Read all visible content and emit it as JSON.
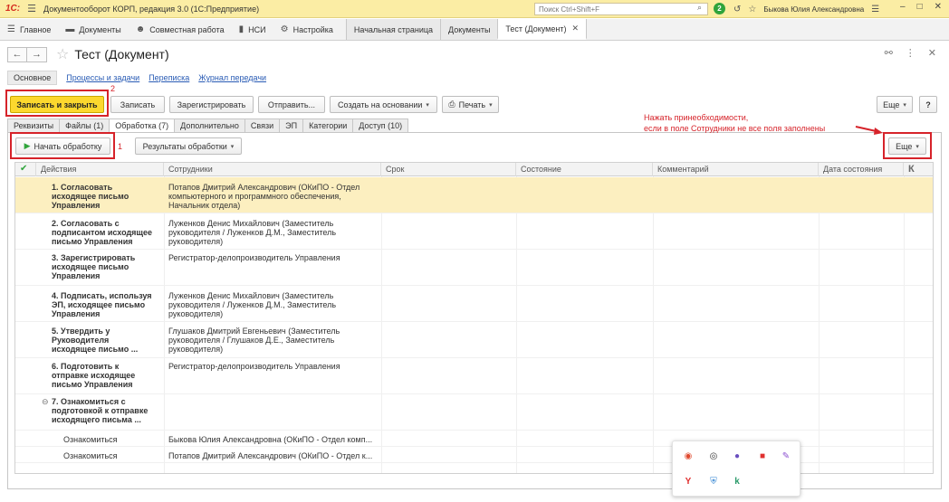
{
  "titlebar": {
    "logo": "1С:",
    "app_title": "Документооборот КОРП, редакция 3.0  (1С:Предприятие)",
    "search_placeholder": "Поиск Ctrl+Shift+F",
    "notification_count": "2",
    "user_name": "Быкова Юлия Александровна"
  },
  "navbar": {
    "sections": [
      {
        "label": "Главное",
        "icon": "menu-icon"
      },
      {
        "label": "Документы",
        "icon": "folder-icon"
      },
      {
        "label": "Совместная работа",
        "icon": "people-icon"
      },
      {
        "label": "НСИ",
        "icon": "book-icon"
      },
      {
        "label": "Настройка",
        "icon": "gear-icon"
      }
    ],
    "open_tabs": [
      {
        "label": "Начальная страница"
      },
      {
        "label": "Документы"
      },
      {
        "label": "Тест (Документ)"
      }
    ]
  },
  "form": {
    "title": "Тест (Документ)",
    "subnav": {
      "current": "Основное",
      "links": [
        "Процессы и задачи",
        "Переписка",
        "Журнал передачи"
      ]
    },
    "toolbar": {
      "save_close": "Записать и закрыть",
      "save": "Записать",
      "register": "Зарегистрировать",
      "send": "Отправить...",
      "create_based": "Создать на основании",
      "print": "Печать",
      "more": "Еще",
      "help": "?"
    },
    "tabs": [
      "Реквизиты",
      "Файлы (1)",
      "Обработка (7)",
      "Дополнительно",
      "Связи",
      "ЭП",
      "Категории",
      "Доступ (10)"
    ],
    "active_tab": "Обработка (7)",
    "processing_toolbar": {
      "start": "Начать обработку",
      "results": "Результаты обработки",
      "more": "Еще"
    },
    "columns": [
      "Действия",
      "Сотрудники",
      "Срок",
      "Состояние",
      "Комментарий",
      "Дата состояния",
      "К"
    ],
    "rows": [
      {
        "action": [
          "1. Согласовать",
          "исходящее письмо",
          "Управления"
        ],
        "employees": [
          "Потапов Дмитрий Александрович (ОКиПО - Отдел",
          "компьютерного и программного обеспечения,",
          "Начальник отдела)"
        ],
        "selected": true
      },
      {
        "action": [
          "2. Согласовать с",
          "подписантом исходящее",
          "письмо Управления"
        ],
        "employees": [
          "Луженков Денис Михайлович (Заместитель",
          "руководителя / Луженков Д.М., Заместитель",
          "руководителя)"
        ],
        "selected": false
      },
      {
        "action": [
          "3. Зарегистрировать",
          "исходящее письмо",
          "Управления"
        ],
        "employees": [
          "Регистратор-делопроизводитель Управления"
        ],
        "selected": false
      },
      {
        "action": [
          "4. Подписать, используя",
          "ЭП, исходящее письмо",
          "Управления"
        ],
        "employees": [
          "Луженков Денис Михайлович (Заместитель",
          "руководителя / Луженков Д.М., Заместитель",
          "руководителя)"
        ],
        "selected": false
      },
      {
        "action": [
          "5. Утвердить у",
          "Руководителя",
          "исходящее письмо ..."
        ],
        "employees": [
          "Глушаков Дмитрий Евгеньевич (Заместитель",
          "руководителя / Глушаков Д.Е., Заместитель",
          "руководителя)"
        ],
        "selected": false
      },
      {
        "action": [
          "6. Подготовить к",
          "отправке исходящее",
          "письмо Управления"
        ],
        "employees": [
          "Регистратор-делопроизводитель Управления"
        ],
        "selected": false
      },
      {
        "action": [
          "7. Ознакомиться с",
          "подготовкой к отправке",
          "исходящего письма ..."
        ],
        "employees": [],
        "selected": false,
        "group": true
      },
      {
        "action": [
          "Ознакомиться"
        ],
        "employees": [
          "Быкова Юлия Александровна (ОКиПО - Отдел комп..."
        ],
        "selected": false,
        "child": true
      },
      {
        "action": [
          "Ознакомиться"
        ],
        "employees": [
          "Потапов Дмитрий Александрович (ОКиПО - Отдел к..."
        ],
        "selected": false,
        "child": true
      }
    ]
  },
  "annotations": {
    "marker_1": "1",
    "marker_2": "2",
    "note_line1": "Нажать принеобходимости,",
    "note_line2": "если в поле Сотрудники не все поля заполнены"
  },
  "colors": {
    "titlebar": "#fbeda4",
    "primary_button": "#fcd82e",
    "selected_row": "#fcefc0",
    "annotation_red": "#d6232a",
    "link_blue": "#2a5cb5"
  }
}
